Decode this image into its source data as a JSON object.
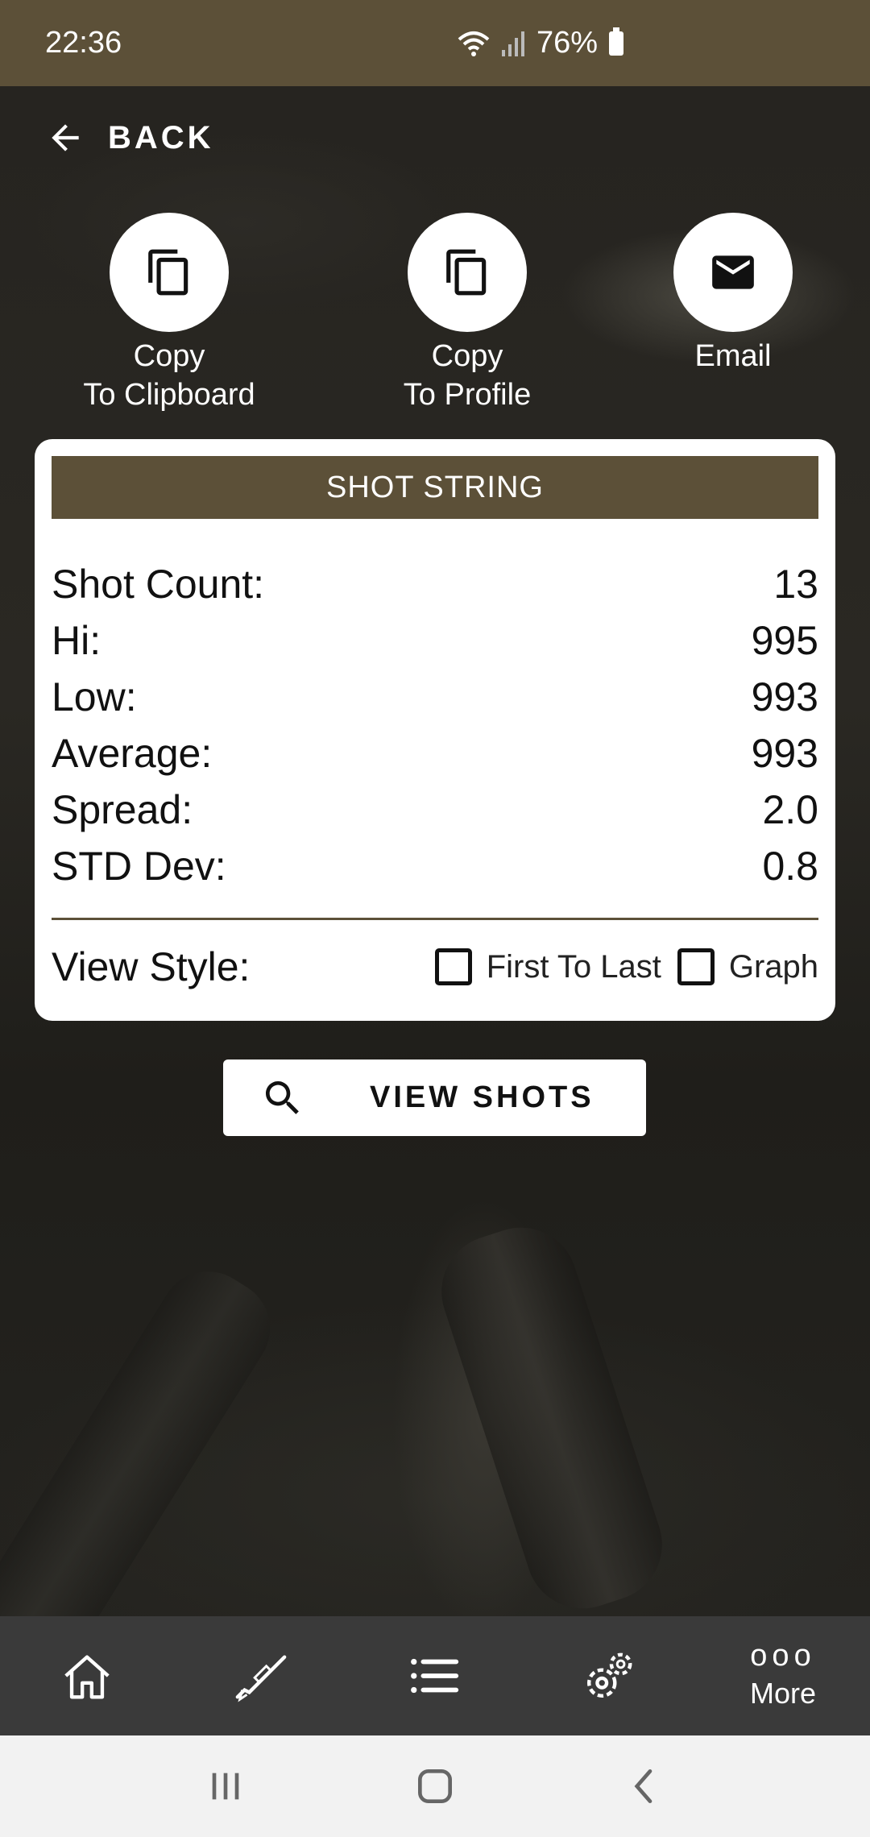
{
  "status_bar": {
    "time": "22:36",
    "battery": "76%"
  },
  "back": {
    "label": "BACK"
  },
  "actions": [
    {
      "label": "Copy\nTo Clipboard",
      "icon": "copy-icon"
    },
    {
      "label": "Copy\nTo Profile",
      "icon": "copy-icon"
    },
    {
      "label": "Email",
      "icon": "mail-icon"
    }
  ],
  "card": {
    "title": "SHOT STRING",
    "stats": [
      {
        "label": "Shot Count:",
        "value": "13"
      },
      {
        "label": "Hi:",
        "value": "995"
      },
      {
        "label": "Low:",
        "value": "993"
      },
      {
        "label": "Average:",
        "value": "993"
      },
      {
        "label": "Spread:",
        "value": "2.0"
      },
      {
        "label": "STD Dev:",
        "value": "0.8"
      }
    ],
    "view_style": {
      "label": "View Style:",
      "options": [
        {
          "label": "First To Last",
          "checked": false
        },
        {
          "label": "Graph",
          "checked": false
        }
      ]
    }
  },
  "view_shots_button": {
    "label": "VIEW SHOTS",
    "icon": "search-icon"
  },
  "bottom_nav": {
    "items": [
      {
        "icon": "home-icon"
      },
      {
        "icon": "rifle-icon"
      },
      {
        "icon": "list-icon"
      },
      {
        "icon": "gears-icon"
      },
      {
        "icon": "more-icon",
        "dots": "ooo",
        "label": "More"
      }
    ]
  },
  "system_nav": {
    "items": [
      "recent-apps-icon",
      "home-circle-icon",
      "back-chevron-icon"
    ]
  },
  "colors": {
    "accent": "#5c5038",
    "nav_bg": "#3a3a3a"
  }
}
